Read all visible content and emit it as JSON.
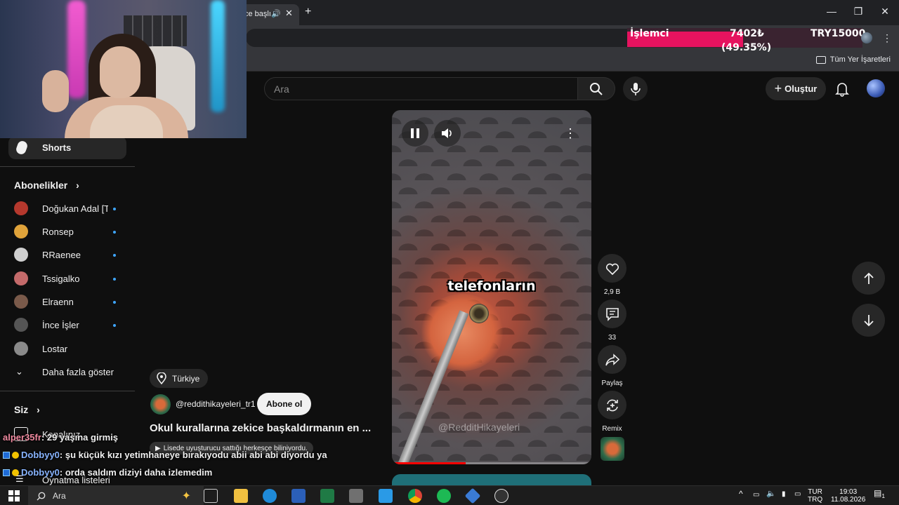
{
  "browser": {
    "tab_title": "ce başlı",
    "tab_audio": "🔊",
    "tab_close": "✕",
    "new_tab": "+",
    "win_min": "—",
    "win_max": "❐",
    "win_close": "✕",
    "menu": "⋮",
    "bookmarks_folder": "Tüm Yer İşaretleri"
  },
  "cpu_overlay": {
    "label": "İşlemci",
    "value": "7402₺",
    "percent_text": "(49.35%)",
    "max": "TRY15000",
    "fill_fraction": 0.4935,
    "bar_color": "#e6135f"
  },
  "header": {
    "search_placeholder": "Ara",
    "create_label": "Oluştur"
  },
  "sidebar": {
    "shorts_label": "Shorts",
    "subscriptions_heading": "Abonelikler",
    "subscriptions": [
      {
        "name": "Doğukan Adal [T...",
        "color": "#b5382d"
      },
      {
        "name": "Ronsep",
        "color": "#e0a33a"
      },
      {
        "name": "RRaenee",
        "color": "#cfcfcf"
      },
      {
        "name": "Tssigalko",
        "color": "#c46a6a"
      },
      {
        "name": "Elraenn",
        "color": "#7a5a4a"
      },
      {
        "name": "İnce İşler",
        "color": "#555555"
      },
      {
        "name": "Lostar",
        "color": "#8a8a8a"
      }
    ],
    "show_more": "Daha fazla göster",
    "you_heading": "Siz",
    "your_channel": "Kanalınız",
    "playlists": "Oynatma listeleri"
  },
  "video": {
    "caption": "telefonların",
    "watermark": "@RedditHikayeleri",
    "progress_fraction": 0.37,
    "location": "Türkiye",
    "channel": "@reddithikayeleri_tr1",
    "subscribe_label": "Abone ol",
    "title": "Okul kurallarına zekice başkaldırmanın en ...",
    "description": "Lisede uyuşturucu sattığı herkesçe biliniyordu."
  },
  "actions": {
    "likes": "2,9 B",
    "comments": "33",
    "share": "Paylaş",
    "remix": "Remix"
  },
  "chat": [
    {
      "user": "alper35fr",
      "message": ": 29 yaşına girmiş"
    },
    {
      "user": "Dobbyy0",
      "message": ": şu küçük kızı yetimhaneye bırakıyodu abii abi abi diyordu ya"
    },
    {
      "user": "Dobbyy0",
      "message": ": orda saldım diziyi daha izlemedim"
    }
  ],
  "taskbar": {
    "search_label": "Ara",
    "lang_top": "TUR",
    "lang_bottom": "TRQ",
    "time": "19:03",
    "date": "11.08.2026",
    "notif_count": "1"
  }
}
